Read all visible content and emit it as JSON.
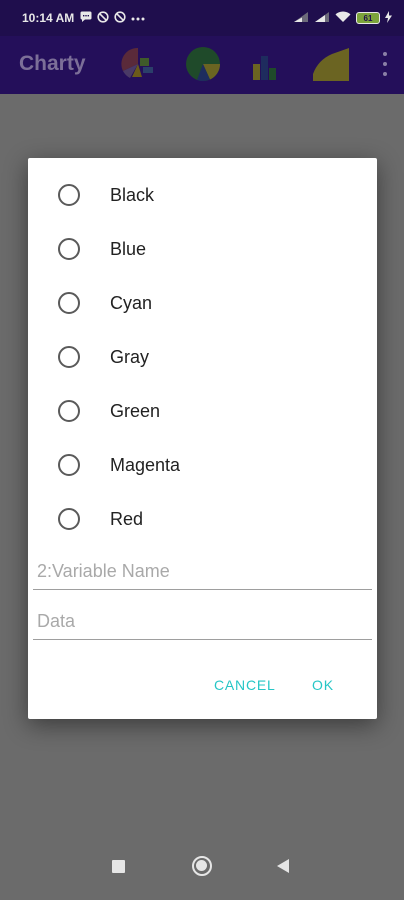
{
  "status_bar": {
    "time": "10:14 AM",
    "left_icons": [
      "message-icon",
      "blocked-icon",
      "blocked-icon",
      "more-dots-icon"
    ],
    "battery_level": "61",
    "right_icons": [
      "signal-icon",
      "signal-icon",
      "wifi-icon",
      "battery-icon",
      "charging-icon"
    ]
  },
  "app_bar": {
    "title": "Charty",
    "actions": [
      "pie-chart-icon",
      "donut-chart-icon",
      "bar-chart-icon",
      "area-chart-icon",
      "overflow-menu-icon"
    ]
  },
  "dialog": {
    "color_options": [
      {
        "label": "Black",
        "selected": false
      },
      {
        "label": "Blue",
        "selected": false
      },
      {
        "label": "Cyan",
        "selected": false
      },
      {
        "label": "Gray",
        "selected": false
      },
      {
        "label": "Green",
        "selected": false
      },
      {
        "label": "Magenta",
        "selected": false
      },
      {
        "label": "Red",
        "selected": false
      }
    ],
    "variable_name": {
      "value": "",
      "placeholder": "2:Variable Name"
    },
    "data_field": {
      "value": "",
      "placeholder": "Data"
    },
    "cancel_label": "CANCEL",
    "ok_label": "OK"
  },
  "colors": {
    "accent": "#26c6c6",
    "app_bar": "#240f5a",
    "scrim": "#6b6b6b"
  },
  "nav_bar": {
    "buttons": [
      "recents-icon",
      "home-icon",
      "back-icon"
    ]
  }
}
